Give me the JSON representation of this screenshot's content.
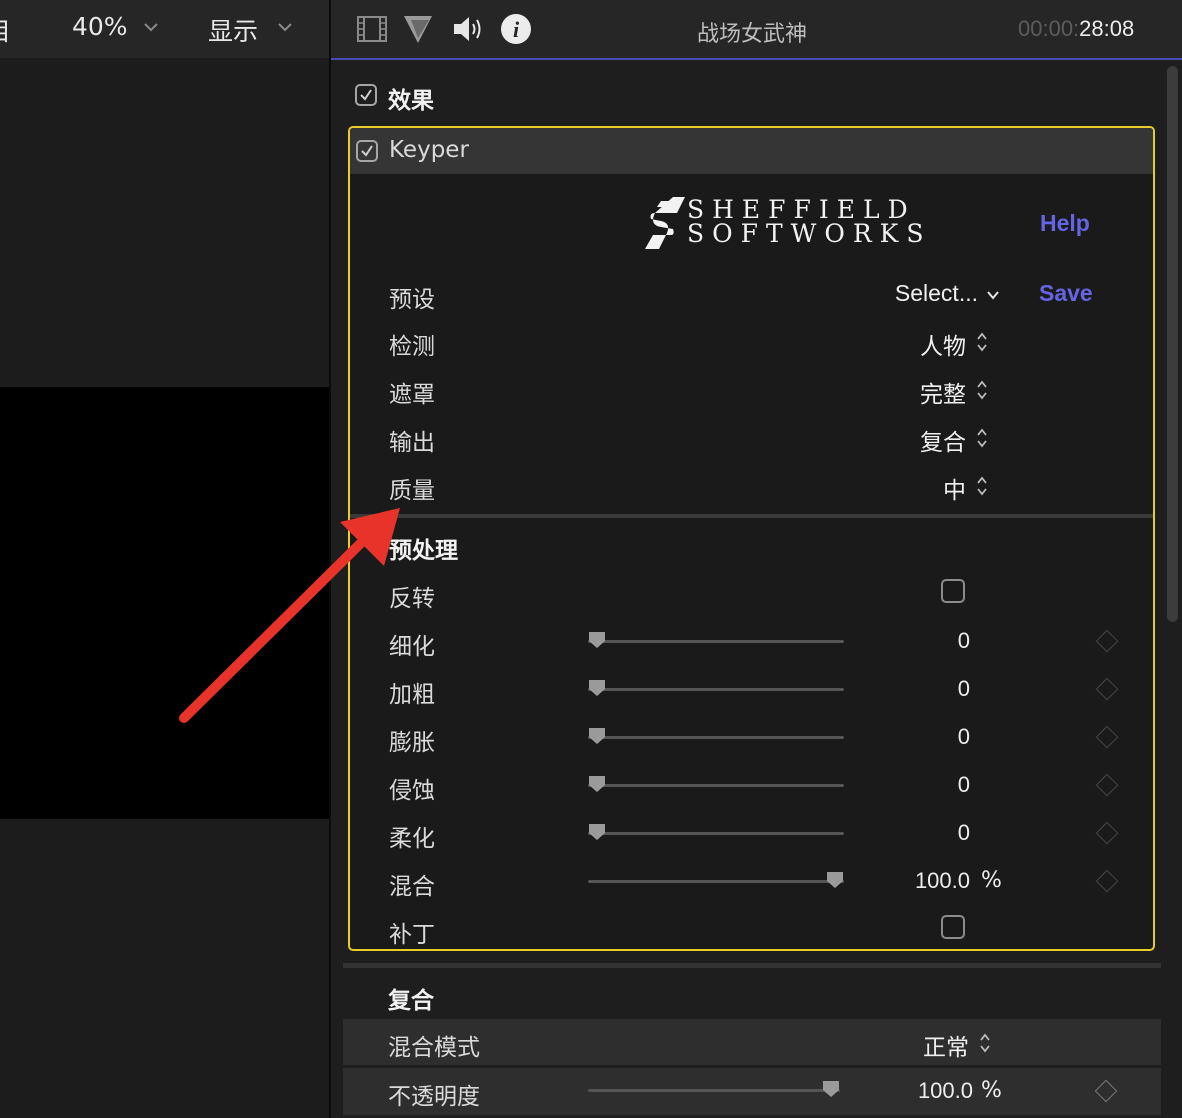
{
  "viewer": {
    "toolbar": {
      "left_cut_text": "目",
      "zoom_label": "40%",
      "view_label": "显示"
    }
  },
  "inspector": {
    "header": {
      "clip_name": "战场女武神",
      "timecode_dim": "00:00:",
      "timecode_bright": "28:08",
      "icons": [
        "film-icon",
        "color-triangle-icon",
        "speaker-icon",
        "info-icon"
      ]
    },
    "effects": {
      "label": "效果",
      "checked": true
    },
    "keyper": {
      "title": "Keyper",
      "checked": true,
      "logo_line1": "SHEFFIELD",
      "logo_line2": "SOFTWORKS",
      "help_label": "Help",
      "save_label": "Save",
      "params": [
        {
          "label": "预设",
          "value": "Select...",
          "control": "dropdown"
        },
        {
          "label": "检测",
          "value": "人物",
          "control": "popup"
        },
        {
          "label": "遮罩",
          "value": "完整",
          "control": "popup"
        },
        {
          "label": "输出",
          "value": "复合",
          "control": "popup"
        },
        {
          "label": "质量",
          "value": "中",
          "control": "popup"
        }
      ],
      "preprocess": {
        "heading": "预处理",
        "invert": {
          "label": "反转",
          "checked": false
        },
        "sliders": [
          {
            "label": "细化",
            "value": "0",
            "level": 0
          },
          {
            "label": "加粗",
            "value": "0",
            "level": 0
          },
          {
            "label": "膨胀",
            "value": "0",
            "level": 0
          },
          {
            "label": "侵蚀",
            "value": "0",
            "level": 0
          },
          {
            "label": "柔化",
            "value": "0",
            "level": 0
          },
          {
            "label": "混合",
            "value": "100.0",
            "unit": "%",
            "level": 1
          }
        ],
        "patch": {
          "label": "补丁",
          "checked": false
        }
      }
    },
    "composite": {
      "heading": "复合",
      "blend_mode": {
        "label": "混合模式",
        "value": "正常"
      },
      "opacity": {
        "label": "不透明度",
        "value": "100.0",
        "unit": "%",
        "level": 1
      }
    }
  },
  "colors": {
    "accent_blue": "#6464e4",
    "selection_yellow": "#e8cc2a",
    "annotation_red": "#e8332b"
  }
}
